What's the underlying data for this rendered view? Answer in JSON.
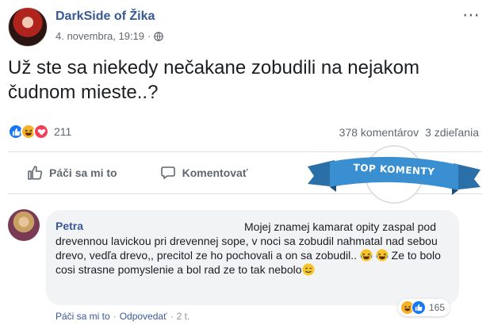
{
  "post": {
    "author": "DarkSide of Žika",
    "timestamp": "4. novembra, 19:19",
    "meta_separator": "·",
    "text": "Už ste sa niekedy nečakane zobudili na nejakom čudnom mieste..?",
    "more_icon": "⋯"
  },
  "reactions": {
    "types": [
      "like-icon",
      "haha-icon",
      "love-icon"
    ],
    "count": "211",
    "comments": "378 komentárov",
    "shares": "3 zdieľania"
  },
  "actions": {
    "like": "Páči sa mi to",
    "comment": "Komentovať"
  },
  "ribbon": {
    "label": "TOP KOMENTY",
    "color": "#3a8fd0"
  },
  "comment": {
    "author": "Petra",
    "text_part1": "Mojej znamej kamarat opity zaspal pod drevennou lavickou pri drevennej sope, v noci sa zobudil nahmatal nad sebou drevo, vedľa drevo,, precitol ze ho pochovali a on sa zobudil..",
    "text_part2": "Ze to bolo cosi strasne pomyslenie a bol rad ze to tak nebolo",
    "reaction_count": "165",
    "like_link": "Páči sa mi to",
    "reply_link": "Odpovedať",
    "time": "2 t.",
    "separator": "·"
  },
  "colors": {
    "link": "#385898",
    "like": "#1877f2",
    "haha": "#f7b125",
    "love": "#f33e58"
  }
}
